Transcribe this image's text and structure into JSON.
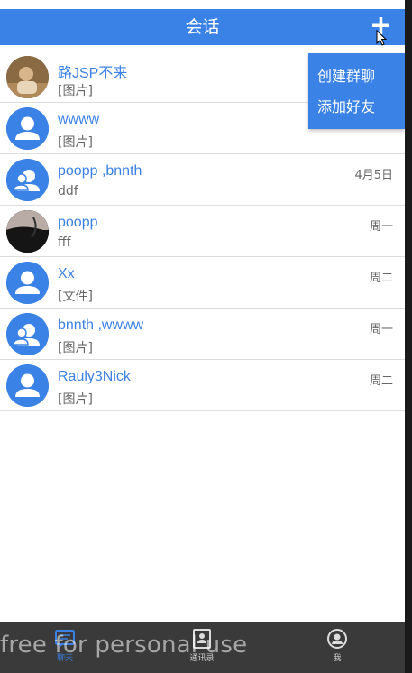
{
  "header": {
    "title": "会话",
    "add_label": "+"
  },
  "popup_menu": {
    "items": [
      {
        "label": "创建群聊"
      },
      {
        "label": "添加好友"
      }
    ]
  },
  "conversations": [
    {
      "name": "路JSP不来",
      "message": "[图片]",
      "time": "",
      "avatar": "photo-person-icon"
    },
    {
      "name": "wwww",
      "message": "[图片]",
      "time": "",
      "avatar": "default-user-icon"
    },
    {
      "name": "poopp ,bnnth",
      "message": "ddf",
      "time": "4月5日",
      "avatar": "group-user-icon"
    },
    {
      "name": "poopp",
      "message": "fff",
      "time": "周一",
      "avatar": "photo-dark-icon"
    },
    {
      "name": "Xx",
      "message": "[文件]",
      "time": "周二",
      "avatar": "default-user-icon"
    },
    {
      "name": "bnnth ,wwww",
      "message": "[图片]",
      "time": "周一",
      "avatar": "group-user-icon"
    },
    {
      "name": "Rauly3Nick",
      "message": "[图片]",
      "time": "周二",
      "avatar": "default-user-icon"
    }
  ],
  "tabbar": {
    "tabs": [
      {
        "label": "聊天",
        "icon": "chat-icon",
        "active": true
      },
      {
        "label": "通讯录",
        "icon": "contacts-icon",
        "active": false
      },
      {
        "label": "我",
        "icon": "profile-icon",
        "active": false
      }
    ]
  },
  "watermark": "free for personal use",
  "colors": {
    "accent": "#3b82e6",
    "tabbar": "#3a3a3a"
  }
}
